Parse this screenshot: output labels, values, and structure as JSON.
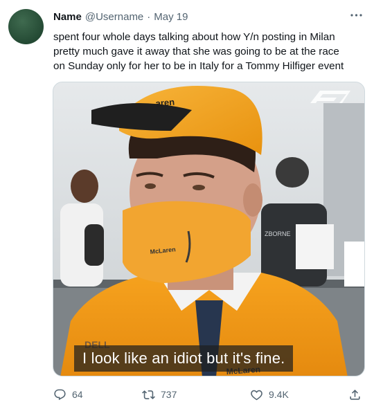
{
  "tweet": {
    "author_name": "Name",
    "handle": "@Username",
    "separator": "·",
    "date": "May 19",
    "text_lines": [
      "spent four whole days talking about how Y/n posting in Milan",
      "pretty much gave it away that she was going to be at the race",
      "on Sunday only for her to be in Italy for a Tommy Hilfiger event"
    ]
  },
  "media": {
    "caption": "I look like an idiot but it's fine.",
    "cap_logo": "aren",
    "mask_logo": "McLaren",
    "chest_logo": "McLaren",
    "sponsor_logo": "DELL",
    "bg_sign": "ZBORNE",
    "watermark": "F1"
  },
  "actions": {
    "reply_count": "64",
    "retweet_count": "737",
    "like_count": "9.4K"
  },
  "colors": {
    "accent_orange": "#f5a623",
    "text_secondary": "#536471"
  }
}
